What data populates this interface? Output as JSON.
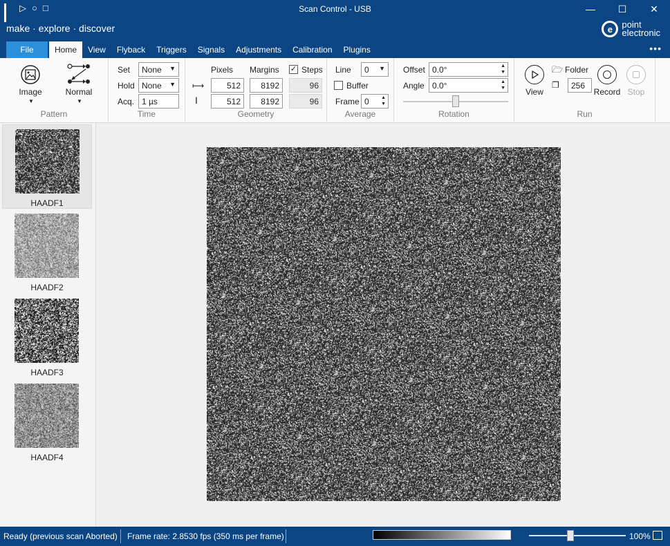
{
  "window": {
    "title": "Scan Control - USB",
    "tagline": "make · explore · discover",
    "logo": {
      "line1": "point",
      "line2": "electronic"
    },
    "controls": {
      "minimize": "—",
      "maximize": "☐",
      "close": "✕"
    }
  },
  "tabs": {
    "file": "File",
    "items": [
      "Home",
      "View",
      "Flyback",
      "Triggers",
      "Signals",
      "Adjustments",
      "Calibration",
      "Plugins"
    ],
    "active": "Home",
    "more": "•••"
  },
  "ribbon": {
    "pattern": {
      "label": "Pattern",
      "image_label": "Image",
      "normal_label": "Normal"
    },
    "time": {
      "label": "Time",
      "set_label": "Set",
      "set_value": "None",
      "hold_label": "Hold",
      "hold_value": "None",
      "acq_label": "Acq.",
      "acq_value": "1 µs"
    },
    "geometry": {
      "label": "Geometry",
      "pixels_label": "Pixels",
      "margins_label": "Margins",
      "steps_label": "Steps",
      "steps_checked": "✓",
      "row1": {
        "pixels": "512",
        "margins": "8192",
        "steps": "96"
      },
      "row2": {
        "pixels": "512",
        "margins": "8192",
        "steps": "96"
      }
    },
    "average": {
      "label": "Average",
      "line_label": "Line",
      "line_value": "0",
      "buffer_label": "Buffer",
      "frame_label": "Frame",
      "frame_value": "0"
    },
    "rotation": {
      "label": "Rotation",
      "offset_label": "Offset",
      "offset_value": "0.0°",
      "angle_label": "Angle",
      "angle_value": "0.0°"
    },
    "run": {
      "label": "Run",
      "view_label": "View",
      "folder_label": "Folder",
      "count_value": "256",
      "record_label": "Record",
      "stop_label": "Stop"
    }
  },
  "thumbnails": [
    {
      "name": "HAADF1",
      "selected": true
    },
    {
      "name": "HAADF2",
      "selected": false
    },
    {
      "name": "HAADF3",
      "selected": false
    },
    {
      "name": "HAADF4",
      "selected": false
    }
  ],
  "status": {
    "ready": "Ready (previous scan Aborted)",
    "frame_rate": "Frame rate: 2.8530 fps (350 ms per frame)",
    "zoom": "100%"
  },
  "colors": {
    "brand": "#0b4583",
    "file_tab": "#2c8fdc"
  }
}
